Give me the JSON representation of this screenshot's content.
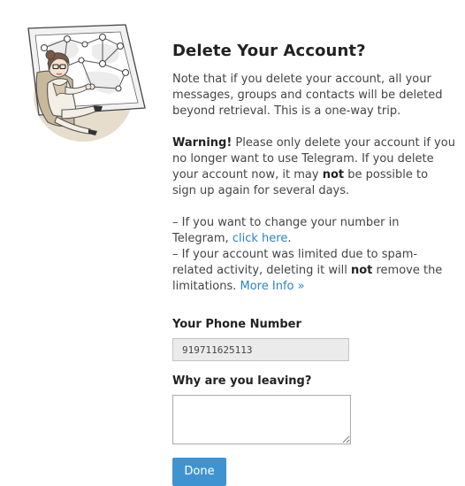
{
  "page": {
    "title": "Delete Your Account?",
    "intro": "Note that if you delete your account, all your messages, groups and contacts will be deleted beyond retrieval. This is a one-way trip.",
    "warning": {
      "bold": "Warning!",
      "text_before": " Please only delete your account if you no longer want to use Telegram. If you delete your account now, it may ",
      "emphasis": "not",
      "text_after": " be possible to sign up again for several days."
    },
    "change_number": {
      "text": "– If you want to change your number in Telegram, ",
      "link": "click here",
      "suffix": "."
    },
    "spam": {
      "text_before": "– If your account was limited due to spam-related activity, deleting it will ",
      "emphasis": "not",
      "text_after": " remove the limitations. ",
      "link": "More Info »"
    }
  },
  "form": {
    "phone_label": "Your Phone Number",
    "phone_value": "919711625113",
    "reason_label": "Why are you leaving?",
    "reason_value": "",
    "submit_label": "Done"
  },
  "colors": {
    "link": "#2a84c4",
    "button": "#3f93d1"
  },
  "illustration": {
    "icon": "telegram-user-at-map-illustration"
  }
}
